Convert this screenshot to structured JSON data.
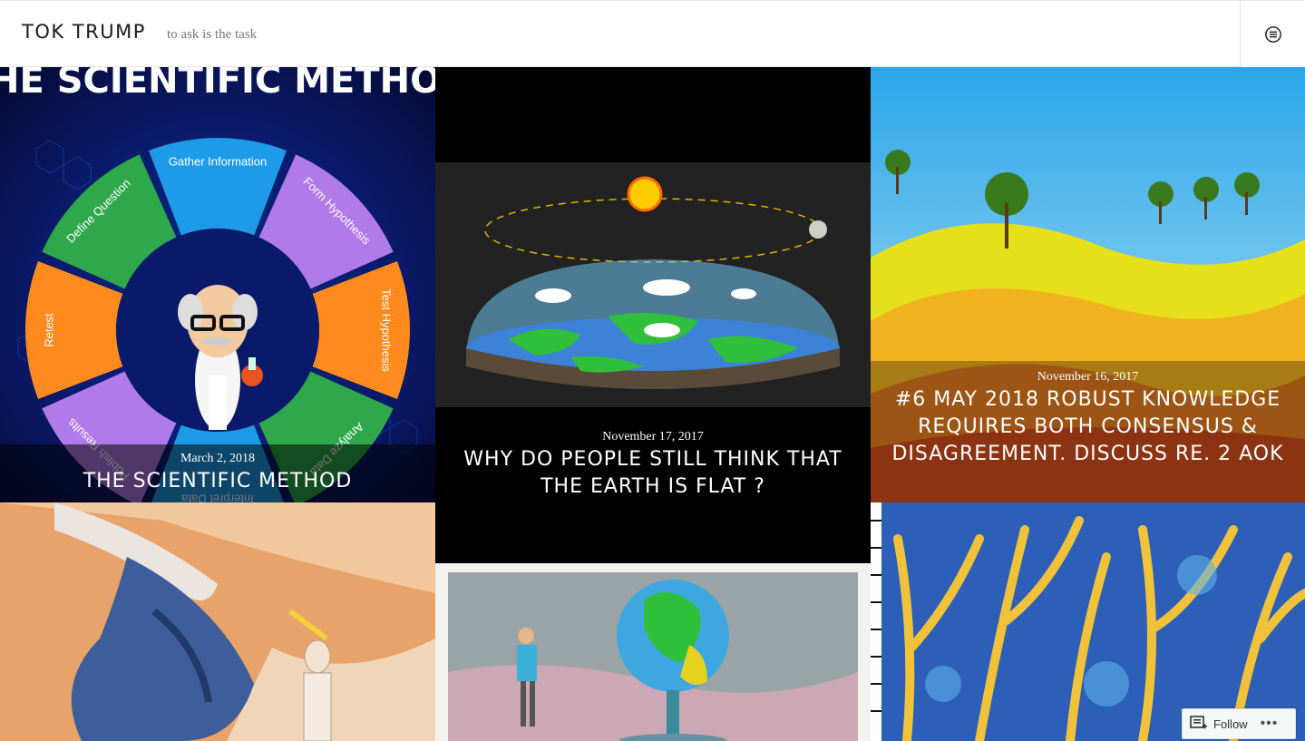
{
  "header": {
    "site_title": "TOK TRUMP",
    "tagline": "to ask is the task",
    "menu_icon": "hamburger-icon"
  },
  "posts": [
    {
      "date": "March 2, 2018",
      "title": "THE SCIENTIFIC METHOD"
    },
    {
      "date": "November 17, 2017",
      "title": "WHY DO PEOPLE STILL THINK THAT THE EARTH IS FLAT ?"
    },
    {
      "date": "November 16, 2017",
      "title": "#6 MAY 2018 ROBUST KNOWLEDGE REQUIRES BOTH CONSENSUS & DISAGREEMENT. DISCUSS RE. 2 AOK"
    }
  ],
  "scientific_method_image": {
    "heading": "THE SCIENTIFIC METHOD",
    "steps": [
      "Gather Information",
      "Form Hypothesis",
      "Test Hypothesis",
      "Analyze Data",
      "Interpret Data",
      "Publish Results",
      "Retest",
      "Define Question"
    ]
  },
  "follow": {
    "label": "Follow",
    "icon": "reader-follow-icon",
    "more_icon": "more-icon"
  },
  "colors": {
    "caption_overlay": "rgba(0,0,0,0.55)",
    "header_border": "#e6e6e6"
  }
}
